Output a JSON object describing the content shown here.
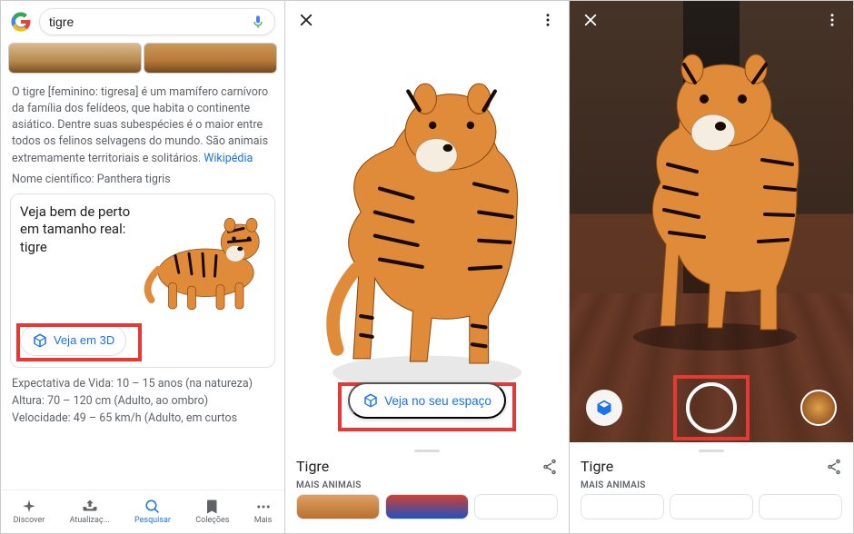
{
  "search": {
    "query": "tigre",
    "placeholder": ""
  },
  "result": {
    "description": "O tigre [feminino: tigresa] é um mamífero carnívoro da família dos felídeos, que habita o continente asiático. Dentre suas subespécies é o maior entre todos os felinos selvagens do mundo. São animais extremamente territoriais e solitários.",
    "source": "Wikipédia",
    "facts": {
      "scientific_label": "Nome científico:",
      "scientific_value": "Panthera tigris",
      "life_label": "Expectativa de Vida:",
      "life_value": "10 – 15 anos (na natureza)",
      "height_label": "Altura:",
      "height_value": "70 – 120 cm (Adulto, ao ombro)",
      "speed_label": "Velocidade:",
      "speed_value": "49 – 65 km/h (Adulto, em curtos"
    }
  },
  "card3d": {
    "title": "Veja bem de perto em tamanho real: tigre",
    "button": "Veja em 3D"
  },
  "bottombar": {
    "items": [
      "Discover",
      "Atualizaç...",
      "Pesquisar",
      "Coleções",
      "Mais"
    ]
  },
  "viewer": {
    "view_in_space": "Veja no seu espaço",
    "sheet_title": "Tigre",
    "more_animals": "MAIS ANIMAIS"
  },
  "colors": {
    "link": "#1a73e8",
    "highlight": "#e53935"
  }
}
